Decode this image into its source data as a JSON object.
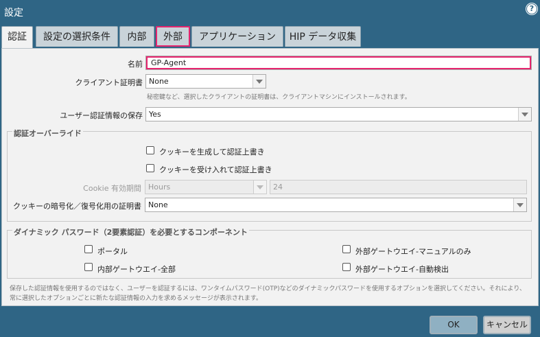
{
  "window": {
    "title": "設定",
    "help_symbol": "?"
  },
  "tabs": [
    {
      "label": "認証"
    },
    {
      "label": "設定の選択条件"
    },
    {
      "label": "内部"
    },
    {
      "label": "外部"
    },
    {
      "label": "アプリケーション"
    },
    {
      "label": "HIP データ収集"
    }
  ],
  "form": {
    "name_label": "名前",
    "name_value": "GP-Agent",
    "client_cert_label": "クライアント証明書",
    "client_cert_value": "None",
    "client_cert_hint": "秘密鍵など、選択したクライアントの証明書は、クライアントマシンにインストールされます。",
    "save_cred_label": "ユーザー認証情報の保存",
    "save_cred_value": "Yes"
  },
  "auth_override": {
    "title": "認証オーバーライド",
    "generate_cookie_label": "クッキーを生成して認証上書き",
    "accept_cookie_label": "クッキーを受け入れて認証上書き",
    "cookie_lifetime_label": "Cookie 有効期間",
    "cookie_lifetime_unit": "Hours",
    "cookie_lifetime_value": "24",
    "encrypt_cert_label": "クッキーの暗号化／復号化用の証明書",
    "encrypt_cert_value": "None"
  },
  "mfa": {
    "title": "ダイナミック パスワード（2要素認証）を必要とするコンポーネント",
    "portal_label": "ポータル",
    "internal_gw_label": "内部ゲートウエイ-全部",
    "external_manual_label": "外部ゲートウエイ-マニュアルのみ",
    "external_auto_label": "外部ゲートウエイ-自動検出",
    "note": "保存した認証情報を使用するのではなく、ユーザーを認証するには、ワンタイムパスワード(OTP)などのダイナミックパスワードを使用するオプションを選択してください。それにより、常に選択したオプションごとに新たな認証情報の入力を求めるメッセージが表示されます。"
  },
  "buttons": {
    "ok": "OK",
    "cancel": "キャンセル"
  }
}
